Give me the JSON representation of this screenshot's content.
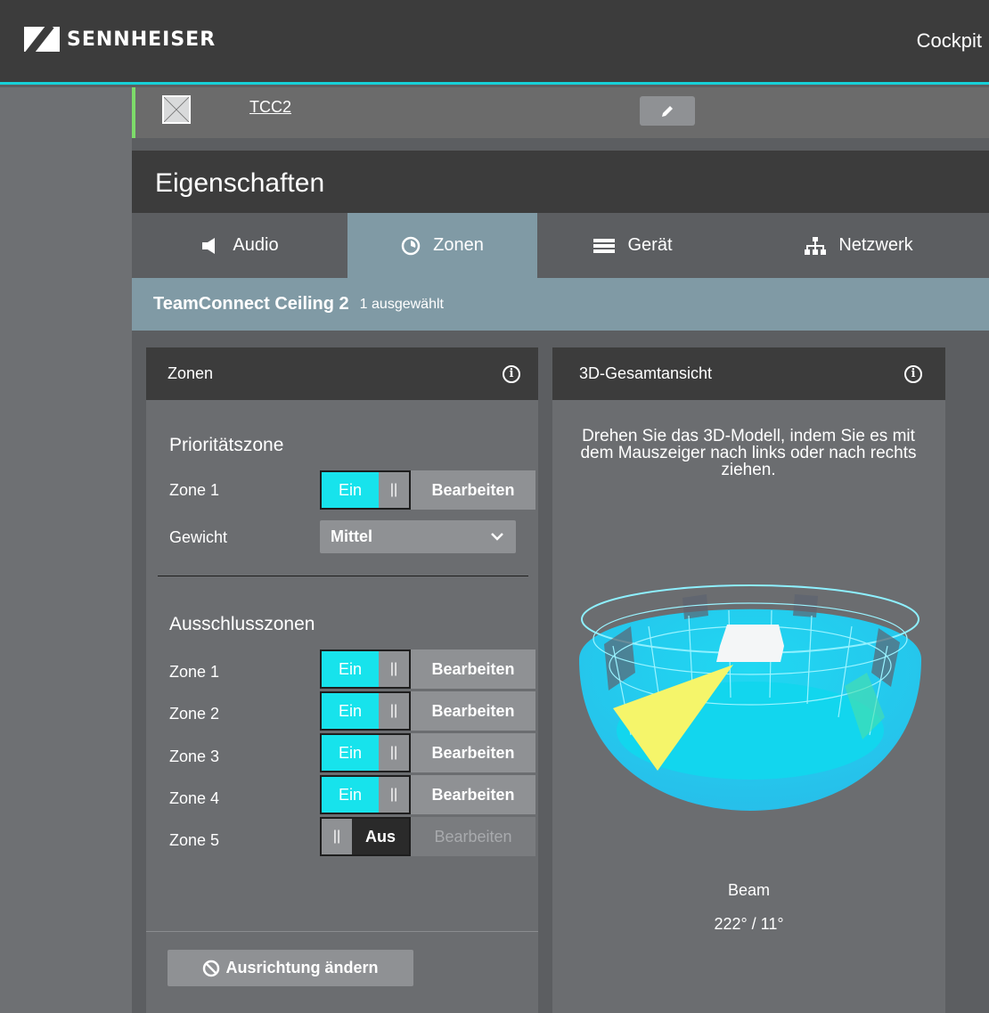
{
  "header": {
    "brand": "SENNHEISER",
    "app_link": "Cockpit"
  },
  "device": {
    "name": "TCC2",
    "status_color": "#7ddb6a"
  },
  "properties": {
    "title": "Eigenschaften"
  },
  "tabs": [
    {
      "label": "Audio",
      "icon": "speaker-icon",
      "active": false
    },
    {
      "label": "Zonen",
      "icon": "zones-icon",
      "active": true
    },
    {
      "label": "Gerät",
      "icon": "device-icon",
      "active": false
    },
    {
      "label": "Netzwerk",
      "icon": "network-icon",
      "active": false
    }
  ],
  "selection": {
    "device_type": "TeamConnect Ceiling 2",
    "count": "1 ausgewählt"
  },
  "zones_panel": {
    "title": "Zonen",
    "priority": {
      "title": "Prioritätszone",
      "zone_label": "Zone 1",
      "toggle_on": "Ein",
      "edit": "Bearbeiten",
      "weight_label": "Gewicht",
      "weight_value": "Mittel"
    },
    "exclusion": {
      "title": "Ausschlusszonen",
      "zones": [
        {
          "label": "Zone 1",
          "state": "Ein",
          "enabled": true,
          "edit": "Bearbeiten"
        },
        {
          "label": "Zone 2",
          "state": "Ein",
          "enabled": true,
          "edit": "Bearbeiten"
        },
        {
          "label": "Zone 3",
          "state": "Ein",
          "enabled": true,
          "edit": "Bearbeiten"
        },
        {
          "label": "Zone 4",
          "state": "Ein",
          "enabled": true,
          "edit": "Bearbeiten"
        },
        {
          "label": "Zone 5",
          "state": "Aus",
          "enabled": false,
          "edit": "Bearbeiten"
        }
      ]
    },
    "orientation_button": "Ausrichtung ändern"
  },
  "view_panel": {
    "title": "3D-Gesamtansicht",
    "hint": "Drehen Sie das 3D-Modell, indem Sie es mit dem Mauszeiger nach links oder nach rechts ziehen.",
    "beam_label": "Beam",
    "beam_value": "222° / 11°"
  },
  "colors": {
    "accent": "#17d0d8",
    "toggle_on": "#17e3ec",
    "tab_active": "#809aa5",
    "beam": "#f5f56a",
    "bowl": "#2ad3f0"
  }
}
